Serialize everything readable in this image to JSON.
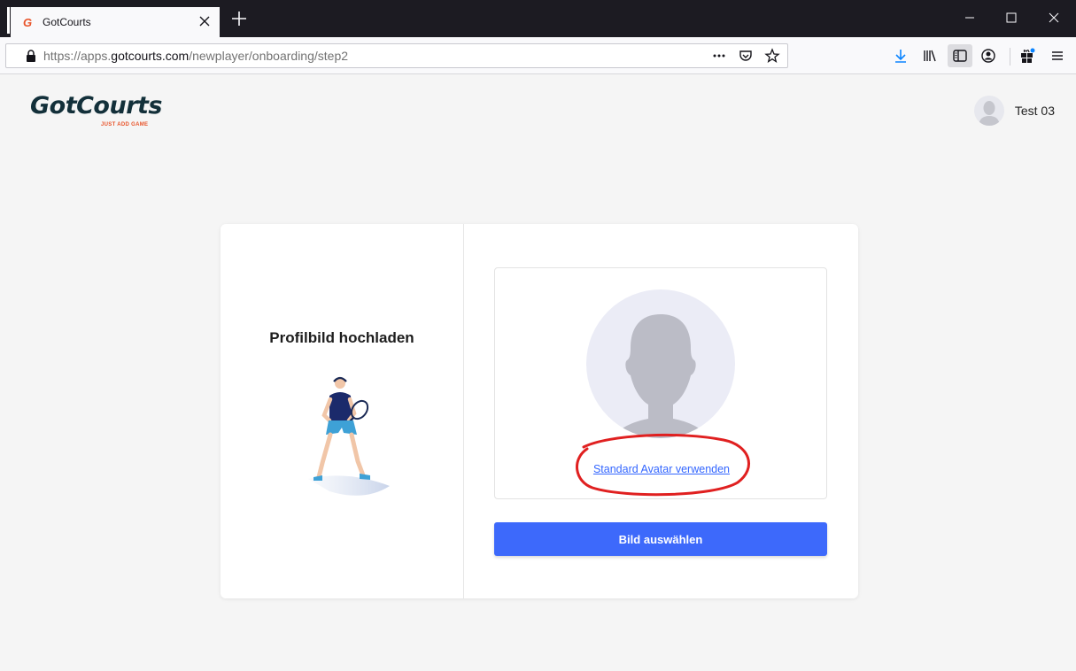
{
  "browser": {
    "tab": {
      "favicon": "G",
      "title": "GotCourts"
    },
    "url": {
      "prefix": "https://apps.",
      "domain": "gotcourts.com",
      "path": "/newplayer/onboarding/step2"
    },
    "icons": [
      "lock-icon",
      "more-icon",
      "pocket-icon",
      "star-icon",
      "download-icon",
      "library-icon",
      "sidebar-icon",
      "account-icon",
      "extensions-icon",
      "menu-icon",
      "minimize-icon",
      "maximize-icon",
      "close-icon"
    ],
    "accent": "#0a84ff"
  },
  "header": {
    "logo": "GotCourts",
    "tagline": "JUST ADD GAME",
    "user_name": "Test 03"
  },
  "card": {
    "title": "Profilbild hochladen",
    "standard_avatar_link": "Standard Avatar verwenden",
    "choose_button": "Bild auswählen"
  },
  "colors": {
    "brand_dark": "#13303a",
    "brand_orange": "#e8542a",
    "primary_button": "#3d69fb",
    "link": "#3366ff",
    "annotation": "#e02020"
  }
}
